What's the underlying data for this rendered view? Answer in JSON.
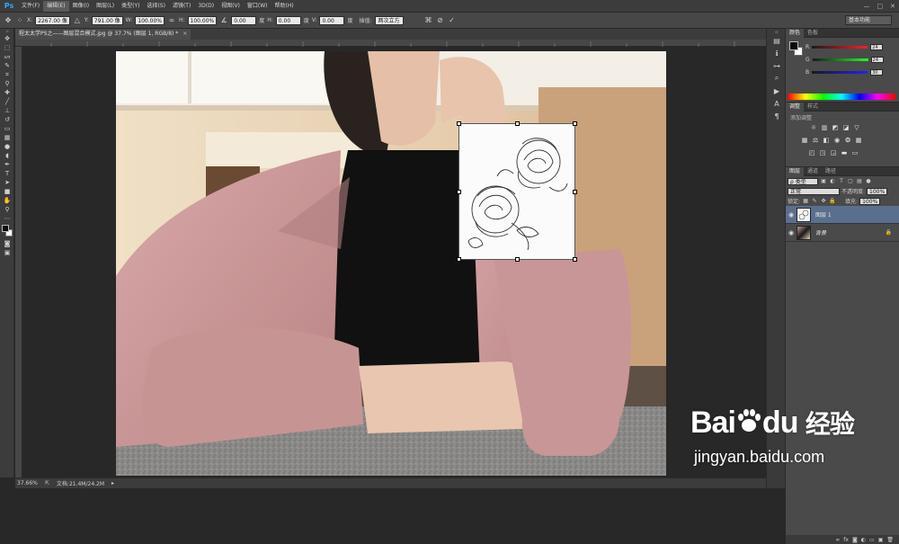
{
  "app": {
    "logo": "Ps"
  },
  "menu": {
    "items": [
      "文件(F)",
      "编辑(E)",
      "图像(I)",
      "图层(L)",
      "类型(Y)",
      "选择(S)",
      "滤镜(T)",
      "3D(D)",
      "视图(V)",
      "窗口(W)",
      "帮助(H)"
    ],
    "active_index": 1
  },
  "window_controls": {
    "minimize": "—",
    "maximize": "□",
    "close": "✕"
  },
  "options": {
    "x_label": "X:",
    "x_value": "2267.00 像",
    "y_label": "Y:",
    "y_value": "791.00 像",
    "w_label": "W:",
    "w_value": "100.00%",
    "h_label": "H:",
    "h_value": "100.00%",
    "angle_value": "0.00",
    "angle_unit": "度",
    "h_skew_label": "H:",
    "h_skew_value": "0.00",
    "h_skew_unit": "度",
    "v_skew_label": "V:",
    "v_skew_value": "0.00",
    "v_skew_unit": "度",
    "interp_label": "插值:",
    "interp_value": "两次立方",
    "workspace": "基本功能"
  },
  "document": {
    "tab_title": "程太太学PS之——图层混合模式.jpg @ 37.7% (图层 1, RGB/8) *",
    "zoom": "37.66%",
    "doc_size": "文档:21.4M/24.2M"
  },
  "color_panel": {
    "tabs": [
      "颜色",
      "色板"
    ],
    "r_label": "R",
    "g_label": "G",
    "b_label": "B",
    "r_value": "24",
    "g_value": "24",
    "b_value": "30",
    "colors": {
      "r": "#c33",
      "g": "#3c3",
      "b": "#33c"
    }
  },
  "adjustments_panel": {
    "tabs": [
      "调整",
      "样式"
    ],
    "add_label": "添加调整"
  },
  "layers_panel": {
    "tabs": [
      "图层",
      "通道",
      "路径"
    ],
    "kind_filter": "ρ 类型",
    "blend_mode": "正常",
    "opacity_label": "不透明度:",
    "opacity_value": "100%",
    "lock_label": "锁定:",
    "fill_label": "填充:",
    "fill_value": "100%",
    "layers": [
      {
        "name": "图层 1",
        "active": true
      },
      {
        "name": "背景",
        "active": false,
        "italic": true
      }
    ]
  },
  "watermark": {
    "brand": "Bai",
    "brand2": "du",
    "suffix": "经验",
    "url": "jingyan.baidu.com"
  },
  "theme": {
    "selection": "#5a6f8e",
    "ps_blue": "#31a8ff"
  }
}
